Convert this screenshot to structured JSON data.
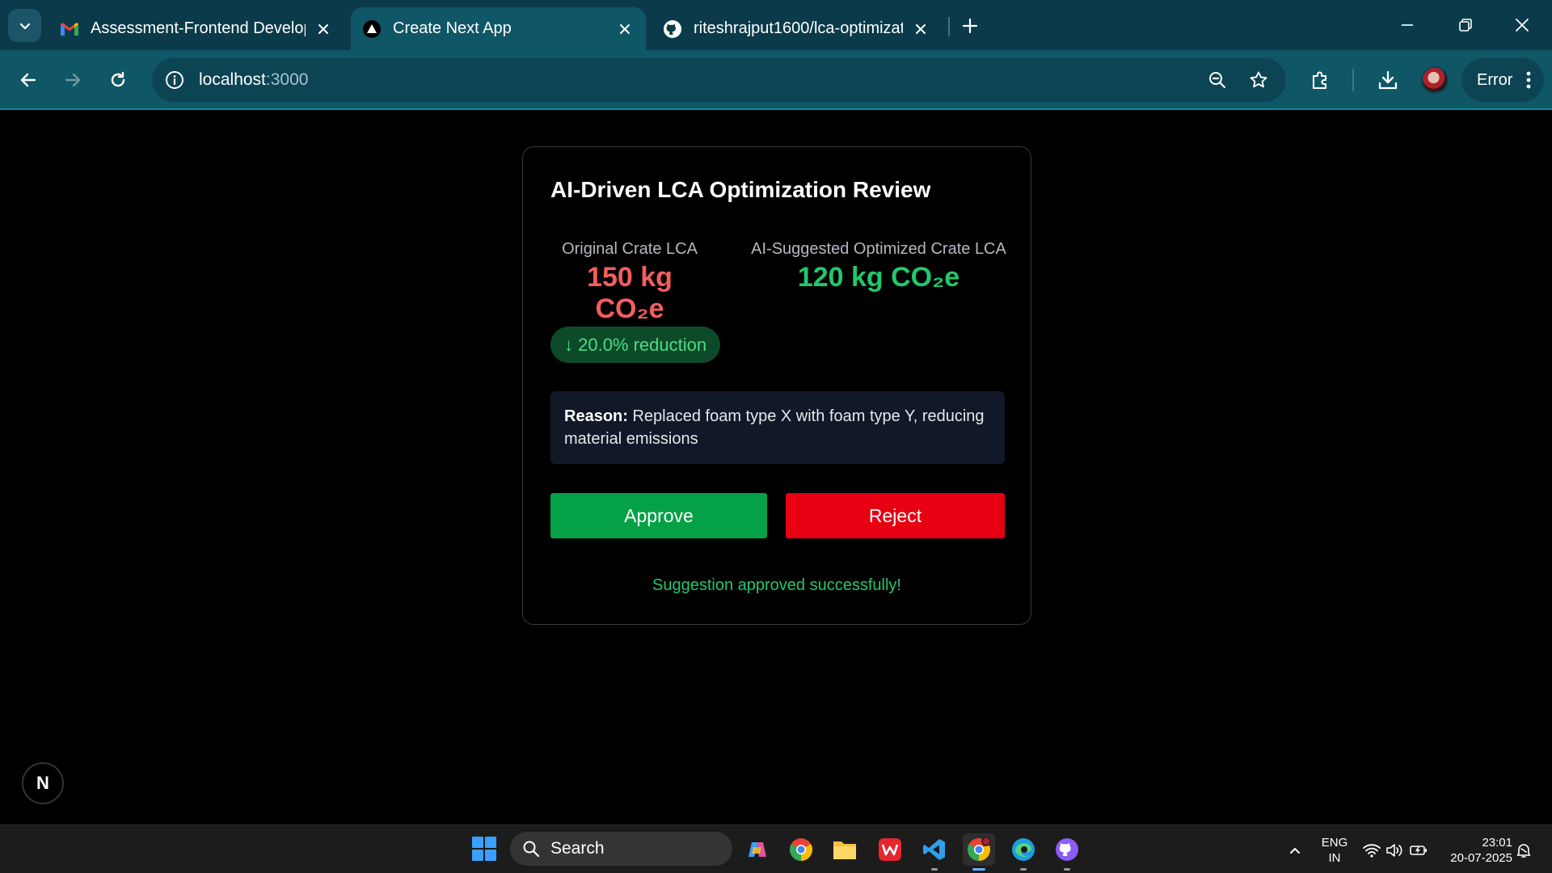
{
  "browser": {
    "tabs": [
      {
        "title": "Assessment-Frontend Develope",
        "icon": "gmail-icon"
      },
      {
        "title": "Create Next App",
        "icon": "nextjs-icon",
        "active": true
      },
      {
        "title": "riteshrajput1600/lca-optimizatic",
        "icon": "github-icon"
      }
    ],
    "url_host": "localhost",
    "url_port": ":3000",
    "profile_status": "Error"
  },
  "page": {
    "title": "AI-Driven LCA Optimization Review",
    "original": {
      "label": "Original Crate LCA",
      "value": "150 kg CO₂e"
    },
    "optimized": {
      "label": "AI-Suggested Optimized Crate LCA",
      "value": "120 kg CO₂e"
    },
    "reduction_badge": "↓ 20.0% reduction",
    "reason_label": "Reason:",
    "reason_text": " Replaced foam type X with foam type Y, reducing material emissions",
    "approve_label": "Approve",
    "reject_label": "Reject",
    "status_message": "Suggestion approved successfully!",
    "dev_indicator": "N"
  },
  "colors": {
    "original_value": "#f55d5d",
    "optimized_value": "#22c86b",
    "approve": "#05a146",
    "reject": "#e60012"
  },
  "taskbar": {
    "search_label": "Search",
    "language": "ENG",
    "region": "IN",
    "time": "23:01",
    "date": "20-07-2025"
  }
}
